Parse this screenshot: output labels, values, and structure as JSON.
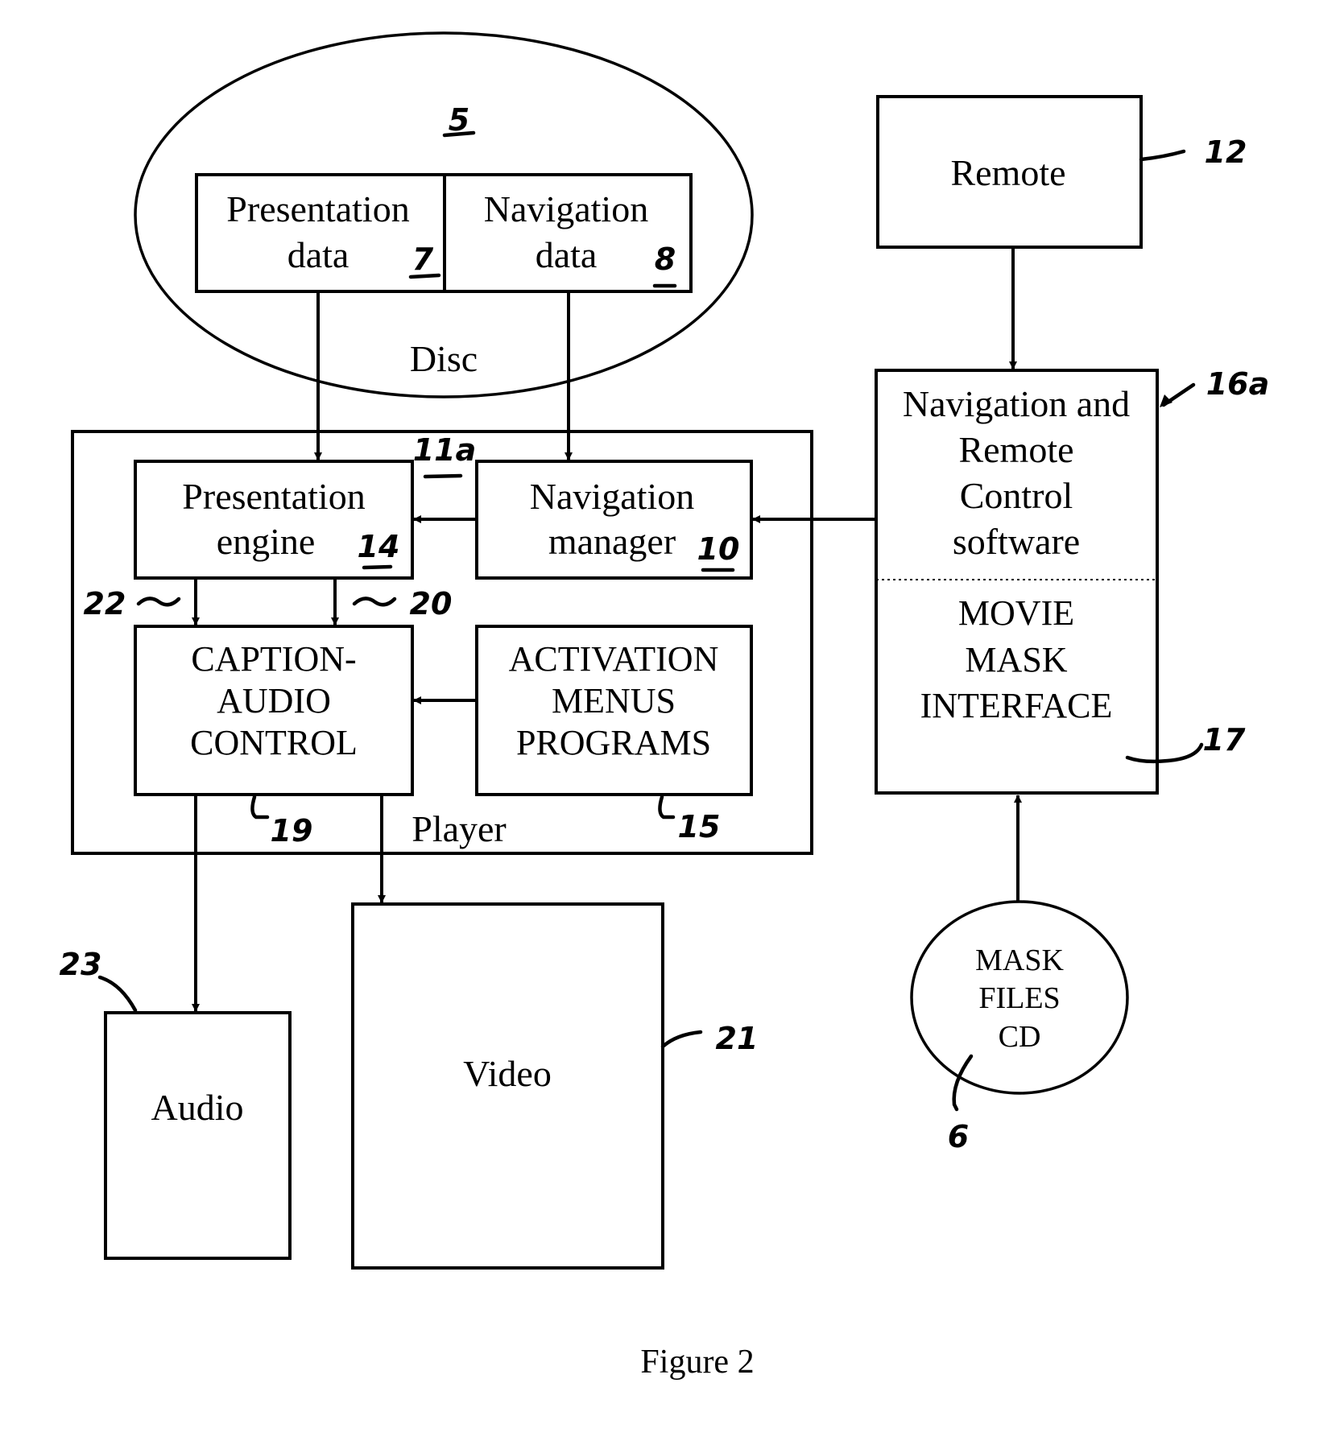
{
  "figure": {
    "caption": "Figure 2"
  },
  "disc": {
    "label": "Disc",
    "ref": "5",
    "presentation_data": {
      "line1": "Presentation",
      "line2": "data",
      "ref": "7"
    },
    "navigation_data": {
      "line1": "Navigation",
      "line2": "data",
      "ref": "8"
    }
  },
  "remote": {
    "label": "Remote",
    "ref": "12"
  },
  "nav_remote_software": {
    "line1": "Navigation and",
    "line2": "Remote",
    "line3": "Control",
    "line4": "software",
    "ref": "16a"
  },
  "movie_mask_interface": {
    "line1": "MOVIE",
    "line2": "MASK",
    "line3": "INTERFACE",
    "ref": "17"
  },
  "player": {
    "label": "Player",
    "ref": "11a",
    "presentation_engine": {
      "line1": "Presentation",
      "line2": "engine",
      "ref": "14"
    },
    "navigation_manager": {
      "line1": "Navigation",
      "line2": "manager",
      "ref": "10"
    },
    "caption_audio_control": {
      "line1": "CAPTION-",
      "line2": "AUDIO",
      "line3": "CONTROL",
      "ref": "19"
    },
    "activation_menus": {
      "line1": "ACTIVATION",
      "line2": "MENUS",
      "line3": "PROGRAMS",
      "ref": "15"
    },
    "connector_refs": {
      "left": "22",
      "right": "20"
    }
  },
  "audio": {
    "label": "Audio",
    "ref": "23"
  },
  "video": {
    "label": "Video",
    "ref": "21"
  },
  "mask_files_cd": {
    "line1": "MASK",
    "line2": "FILES",
    "line3": "CD",
    "ref": "6"
  }
}
